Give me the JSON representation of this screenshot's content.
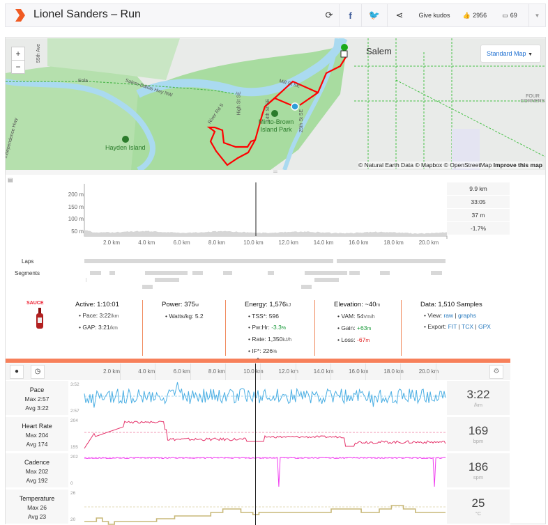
{
  "header": {
    "title": "Lionel Sanders – Run",
    "kudos_label": "Give kudos",
    "kudos_count": "2956",
    "comment_count": "69",
    "icons": [
      "refresh-icon",
      "facebook-icon",
      "twitter-icon",
      "share-icon",
      "thumbs-up-icon",
      "comment-icon",
      "caret-down-icon"
    ]
  },
  "map": {
    "zoom_in": "+",
    "zoom_out": "−",
    "layer_select": "Standard Map",
    "labels": {
      "city": "Salem",
      "park": "Minto-Brown Island Park",
      "island": "Hayden Island",
      "eola": "Eola",
      "hwy": "Salem-Dallas Hwy NW",
      "river_rd": "River Rd S",
      "high_st": "High St SE",
      "mill_st": "Mill St SE",
      "st14": "14th St SE",
      "st25": "25th St SE",
      "four_corners": "FOUR CORNERS",
      "indep": "Independence Hwy",
      "ave55": "55th Ave"
    },
    "attribution": "© Natural Earth Data © Mapbox © OpenStreetMap",
    "improve": "Improve this map",
    "colors": {
      "route": "#ff0000",
      "water": "#aadaf0",
      "park": "#a8dca0"
    }
  },
  "elevation": {
    "y_ticks": [
      "200 m",
      "150 m",
      "100 m",
      "50 m"
    ],
    "x_ticks": [
      "2.0 km",
      "4.0 km",
      "6.0 km",
      "8.0 km",
      "10.0 km",
      "12.0 km",
      "14.0 km",
      "16.0 km",
      "18.0 km",
      "20.0 km"
    ],
    "cursor": {
      "distance": "9.9 km",
      "time": "33:05",
      "elevation": "37 m",
      "grade": "-1.7%"
    },
    "laps_label": "Laps",
    "segments_label": "Segments"
  },
  "stats": {
    "logo": "SAUCE",
    "active": {
      "label": "Active:",
      "value": "1:10:01",
      "pace_label": "• Pace:",
      "pace": "3:22",
      "pace_unit": "/km",
      "gap_label": "• GAP:",
      "gap": "3:21",
      "gap_unit": "/km"
    },
    "power": {
      "label": "Power:",
      "value": "375",
      "unit": "w",
      "wkg_label": "• Watts/kg:",
      "wkg": "5.2"
    },
    "energy": {
      "label": "Energy:",
      "value": "1,576",
      "unit": "kJ",
      "tss_label": "• TSS*:",
      "tss": "596",
      "pwhr_label": "• Pw:Hr:",
      "pwhr": "-3.3",
      "pwhr_unit": "%",
      "rate_label": "• Rate:",
      "rate": "1,350",
      "rate_unit": "kJ/h",
      "if_label": "• IF*:",
      "if": "226",
      "if_unit": "%"
    },
    "elevation": {
      "label": "Elevation:",
      "value": "~40",
      "unit": "m",
      "vam_label": "• VAM:",
      "vam": "54",
      "vam_unit": "Vm/h",
      "gain_label": "• Gain:",
      "gain": "+63",
      "gain_unit": "m",
      "loss_label": "• Loss:",
      "loss": "-67",
      "loss_unit": "m"
    },
    "data": {
      "label": "Data:",
      "value": "1,510 Samples",
      "view_label": "• View:",
      "raw": "raw",
      "graphs": "graphs",
      "export_label": "• Export:",
      "fit": "FIT",
      "tcx": "TCX",
      "gpx": "GPX"
    }
  },
  "toolbar": {
    "icons": [
      "map-pin-icon",
      "clock-icon",
      "gear-icon"
    ],
    "collapse": "^"
  },
  "streams": [
    {
      "name": "Pace",
      "max": "Max 2:57",
      "avg": "Avg 3:22",
      "ymax": "3:52",
      "ymin": "2:57",
      "value": "3:22",
      "unit": "/km",
      "color": "#4aaee3"
    },
    {
      "name": "Heart Rate",
      "max": "Max 204",
      "avg": "Avg 174",
      "ymax": "204",
      "ymin": "155",
      "value": "169",
      "unit": "bpm",
      "color": "#e5326a"
    },
    {
      "name": "Cadence",
      "max": "Max 202",
      "avg": "Avg 192",
      "ymax": "202",
      "ymin": "0",
      "value": "186",
      "unit": "spm",
      "color": "#f03cf0"
    },
    {
      "name": "Temperature",
      "max": "Max 26",
      "avg": "Avg 23",
      "ymax": "26",
      "ymin": "20",
      "value": "25",
      "unit": "°C",
      "color": "#c8b878"
    }
  ]
}
